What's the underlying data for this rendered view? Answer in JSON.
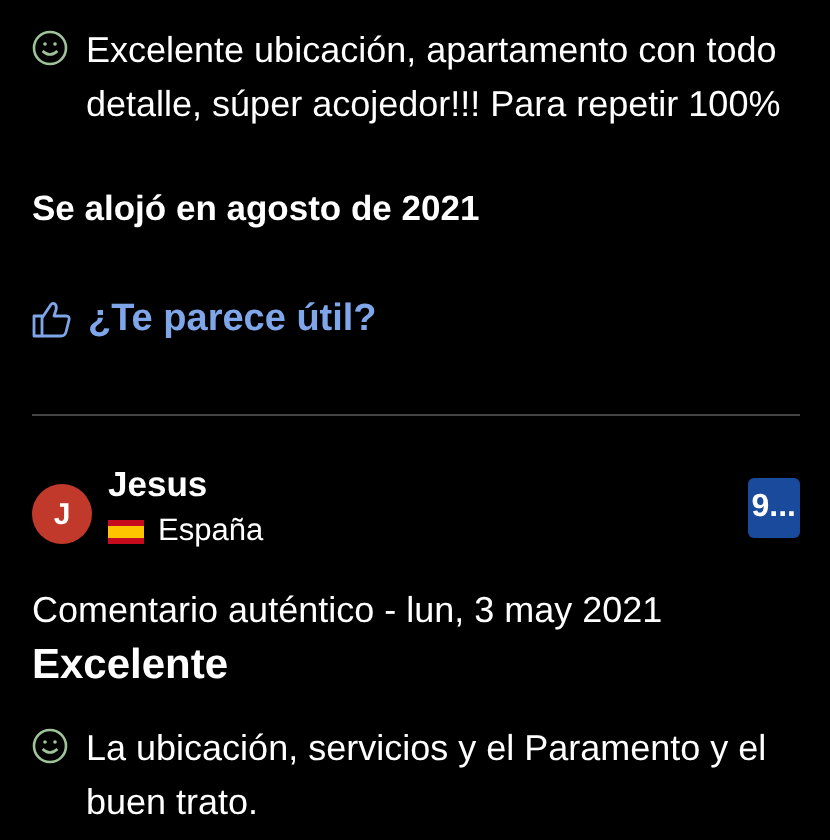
{
  "reviews": [
    {
      "pros": "Excelente ubicación, apartamento con todo detalle, súper acojedor!!! Para repetir 100%",
      "stay": "Se alojó en agosto de 2021",
      "helpful": "¿Te parece útil?"
    },
    {
      "reviewer": {
        "initial": "J",
        "name": "Jesus",
        "country": "España"
      },
      "score": "9...",
      "meta": "Comentario auténtico - lun, 3 may 2021",
      "title": "Excelente",
      "pros": "La ubicación, servicios y el Paramento y el buen trato."
    }
  ]
}
